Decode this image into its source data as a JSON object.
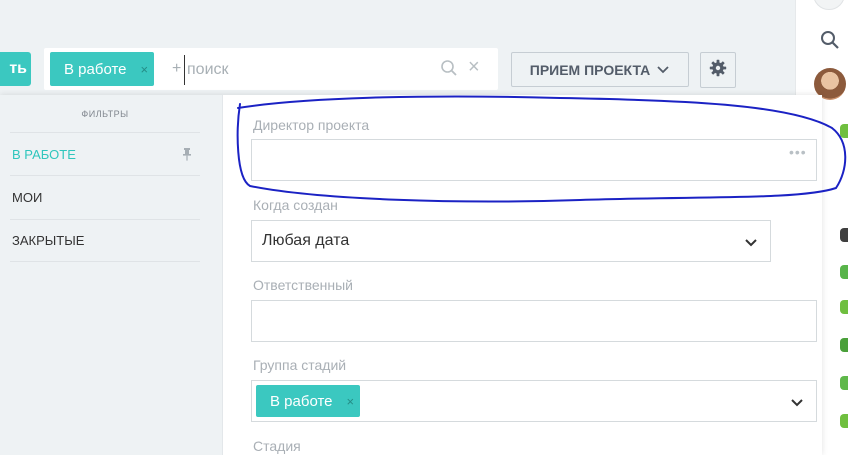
{
  "toolbar": {
    "add_label": "ть",
    "search": {
      "chip_label": "В работе",
      "chip_remove": "×",
      "plus": "+",
      "placeholder": "поиск",
      "clear": "×"
    },
    "project_button_label": "ПРИЕМ ПРОЕКТА"
  },
  "filters": {
    "title": "ФИЛЬТРЫ",
    "items": [
      {
        "label": "В РАБОТЕ",
        "active": true
      },
      {
        "label": "МОИ",
        "active": false
      },
      {
        "label": "ЗАКРЫТЫЕ",
        "active": false
      }
    ]
  },
  "form": {
    "director_label": "Директор проекта",
    "created_label": "Когда создан",
    "created_value": "Любая дата",
    "more": "•••",
    "responsible_label": "Ответственный",
    "stage_group_label": "Группа стадий",
    "stage_group_chip": "В работе",
    "stage_group_chip_remove": "×",
    "stage_label": "Стадия"
  },
  "colors": {
    "accent": "#3bc8c0",
    "annotation": "#1b22c4"
  }
}
